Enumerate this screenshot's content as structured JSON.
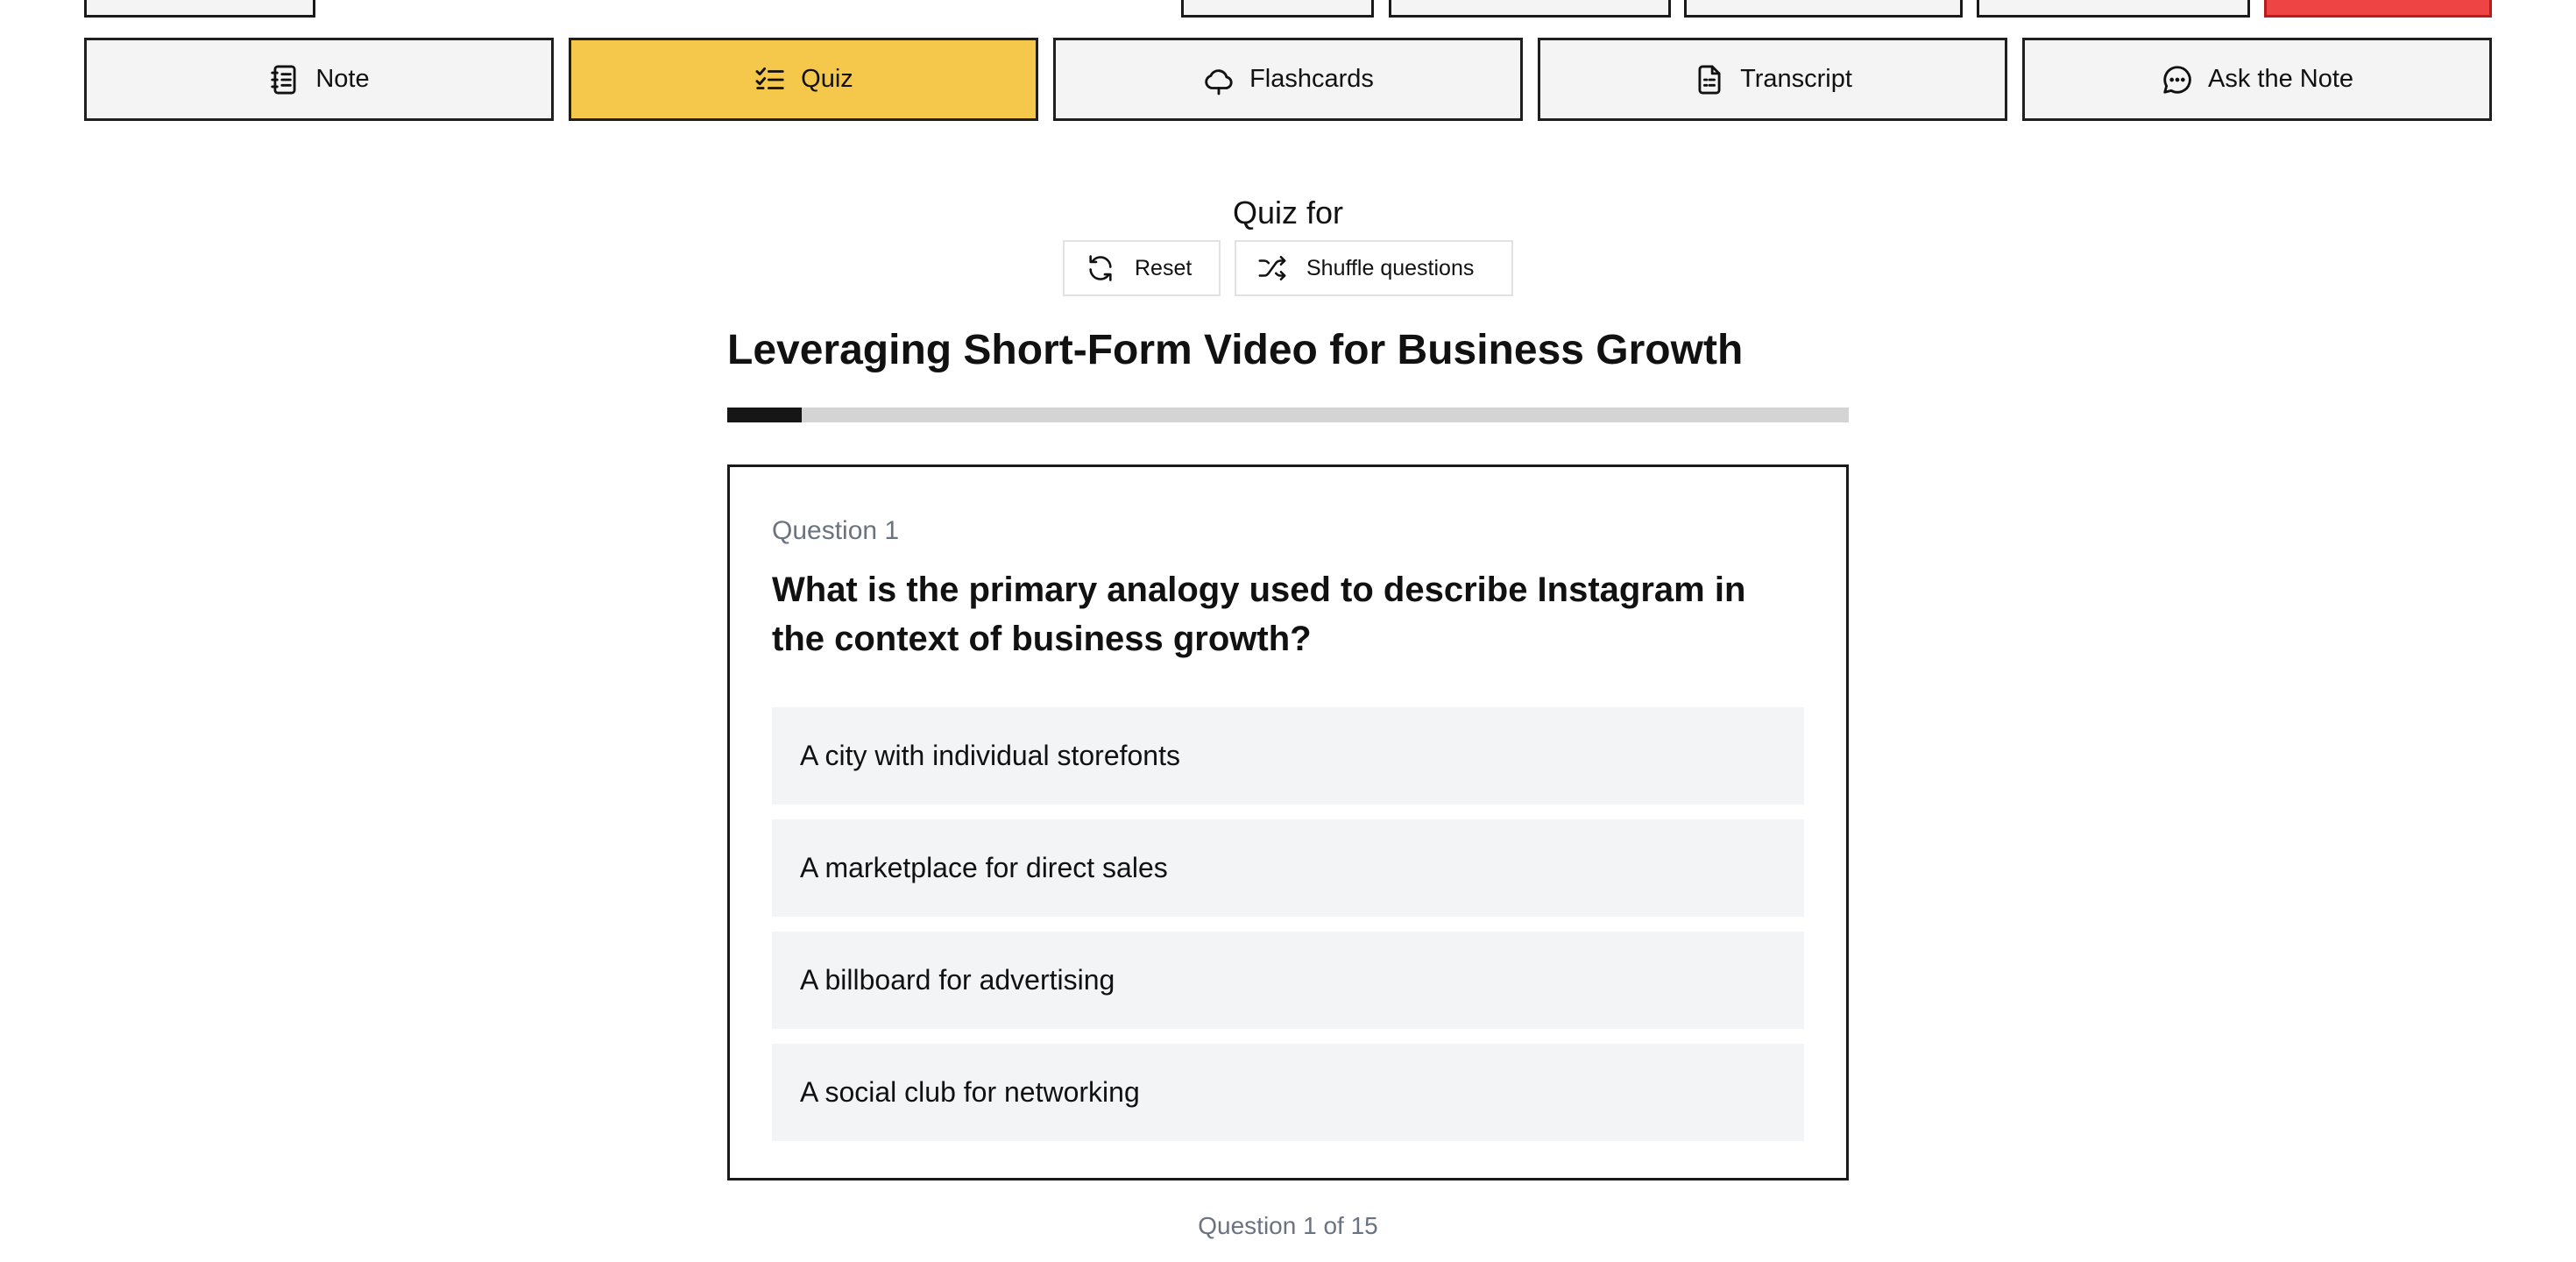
{
  "tabs": [
    {
      "label": "Note",
      "icon": "notebook-icon",
      "active": false
    },
    {
      "label": "Quiz",
      "icon": "checklist-icon",
      "active": true
    },
    {
      "label": "Flashcards",
      "icon": "cloud-icon",
      "active": false
    },
    {
      "label": "Transcript",
      "icon": "document-icon",
      "active": false
    },
    {
      "label": "Ask the Note",
      "icon": "chat-bubble-icon",
      "active": false
    }
  ],
  "quiz": {
    "heading": "Quiz for",
    "reset_label": "Reset",
    "shuffle_label": "Shuffle questions",
    "title": "Leveraging Short-Form Video for Business Growth",
    "progress_fraction": 0.0667,
    "question_number": "Question 1",
    "question_text": "What is the primary analogy used to describe Instagram in the context of business growth?",
    "options": [
      "A city with individual storefonts",
      "A marketplace for direct sales",
      "A billboard for advertising",
      "A social club for networking"
    ],
    "counter": "Question 1 of 15"
  },
  "colors": {
    "active_tab": "#f5c84c",
    "tab_bg": "#f4f4f5",
    "option_bg": "#f3f4f6",
    "progress_fill": "#161616",
    "progress_track": "#d4d4d4",
    "danger": "#ef4444"
  }
}
